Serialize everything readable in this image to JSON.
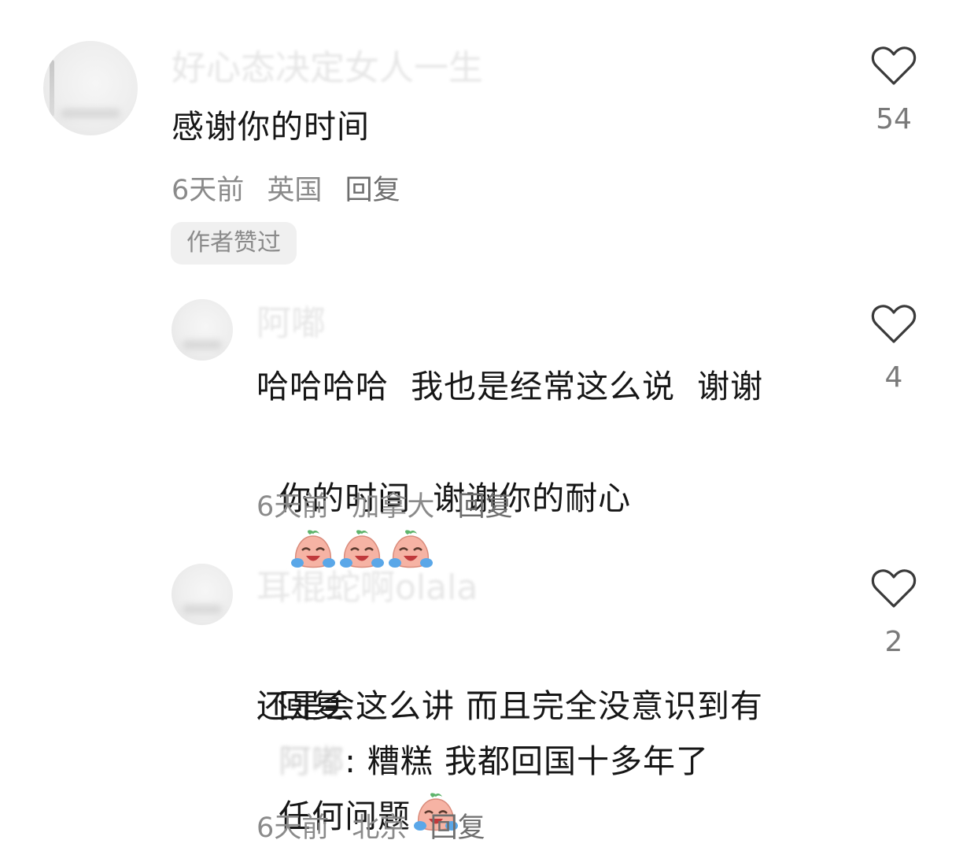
{
  "comments": [
    {
      "username": "好心态决定女人一生",
      "text": "感谢你的时间",
      "time": "6天前",
      "location": "英国",
      "reply_label": "回复",
      "badge": "作者赞过",
      "likes": "54"
    },
    {
      "username": "阿嘟",
      "text_line1": "哈哈哈哈  我也是经常这么说  谢谢",
      "text_line2": "你的时间  谢谢你的耐心",
      "time": "6天前",
      "location": "加拿大",
      "reply_label": "回复",
      "likes": "4",
      "emoji": "crying-laughing-peach-emoji"
    },
    {
      "username": "耳棍蛇啊olala",
      "reply_prefix": "回复",
      "reply_to": "阿嘟",
      "text_line1": ": 糟糕 我都回国十多年了",
      "text_line2": "还是会这么讲 而且完全没意识到有",
      "text_line3": "任何问题",
      "time": "6天前",
      "location": "北京",
      "reply_label": "回复",
      "likes": "2",
      "emoji": "crying-laughing-peach-emoji"
    }
  ],
  "colors": {
    "muted": "#8a8a8a",
    "badge_bg": "#f0f0f0",
    "emoji_body": "#f6b3a4",
    "tears": "#5aa7e8"
  },
  "icons": {
    "like": "heart-outline-icon"
  }
}
